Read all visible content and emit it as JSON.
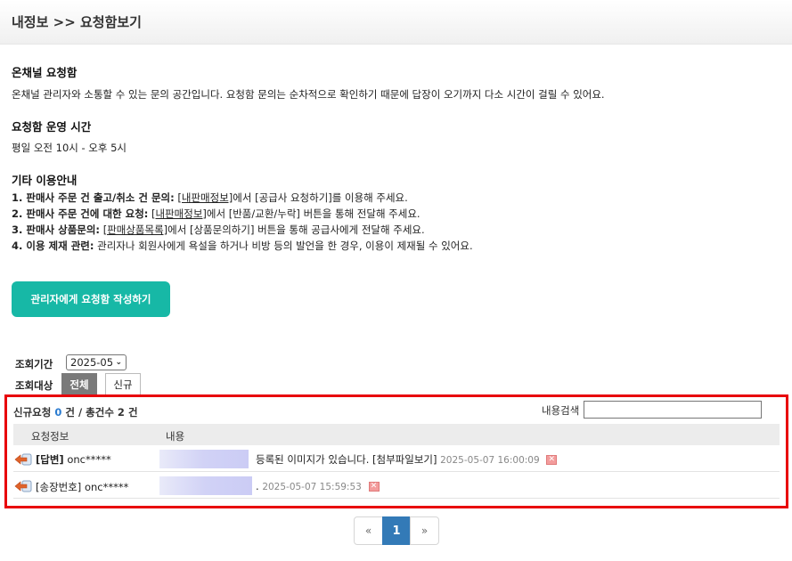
{
  "header": {
    "title": "내정보 >> 요청함보기"
  },
  "intro": {
    "title": "온채널 요청함",
    "text": "온채널 관리자와 소통할 수 있는 문의 공간입니다. 요청함 문의는 순차적으로 확인하기 때문에 답장이 오기까지 다소 시간이 걸릴 수 있어요."
  },
  "hours": {
    "title": "요청함 운영 시간",
    "text": "평일 오전 10시 - 오후 5시"
  },
  "guide": {
    "title": "기타 이용안내",
    "items": [
      {
        "label": "1. 판매사 주문 건 출고/취소 건 문의:",
        "link": "[내판매정보]",
        "text": "에서 [공급사 요청하기]를 이용해 주세요."
      },
      {
        "label": "2. 판매사 주문 건에 대한 요청:",
        "link": "[내판매정보]",
        "text": "에서 [반품/교환/누락] 버튼을 통해 전달해 주세요."
      },
      {
        "label": "3. 판매사 상품문의:",
        "link": "[판매상품목록]",
        "text": "에서 [상품문의하기] 버튼을 통해 공급사에게 전달해 주세요."
      },
      {
        "label": "4. 이용 제재 관련:",
        "link": "",
        "text": "관리자나 회원사에게 욕설을 하거나 비방 등의 발언을 한 경우, 이용이 제재될 수 있어요."
      }
    ]
  },
  "write_button": {
    "label": "관리자에게 요청함 작성하기"
  },
  "filter": {
    "period_label": "조회기간",
    "period_value": "2025-05",
    "target_label": "조회대상",
    "tabs": [
      "전체",
      "신규"
    ]
  },
  "summary": {
    "new_label": "신규요청",
    "new_count": "0",
    "unit1": "건 / 총건수",
    "total_count": "2",
    "unit2": "건"
  },
  "search": {
    "label": "내용검색",
    "value": ""
  },
  "table": {
    "headers": [
      "요청정보",
      "내용"
    ],
    "rows": [
      {
        "type": "[답변]",
        "user": "onc*****",
        "content": "등록된 이미지가 있습니다.",
        "attachment": "[첨부파일보기]",
        "timestamp": "2025-05-07 16:00:09"
      },
      {
        "type": "[송장번호]",
        "user": "onc*****",
        "content": ".",
        "attachment": "",
        "timestamp": "2025-05-07 15:59:53"
      }
    ]
  },
  "pagination": {
    "prev": "«",
    "current": "1",
    "next": "»"
  },
  "colors": {
    "accent": "#17b8a6",
    "highlight_border": "#e8000b",
    "page_active": "#337ab7",
    "count_blue": "#2a7bd0"
  },
  "icons": {
    "row_icon": "reply-arrow-icon",
    "delete_icon": "delete-x-icon"
  }
}
